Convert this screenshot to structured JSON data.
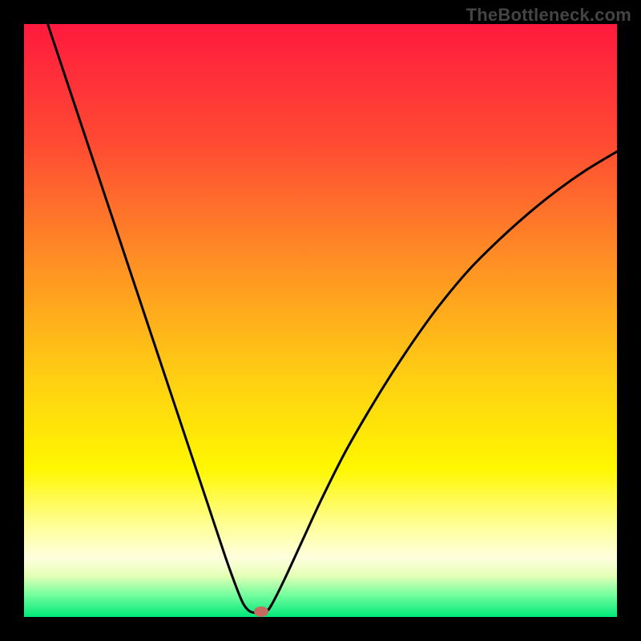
{
  "watermark": "TheBottleneck.com",
  "chart_data": {
    "type": "line",
    "title": "",
    "xlabel": "",
    "ylabel": "",
    "xlim": [
      0,
      100
    ],
    "ylim": [
      0,
      100
    ],
    "gradient_stops": [
      {
        "offset": 0.0,
        "color": "#ff1a3e"
      },
      {
        "offset": 0.2,
        "color": "#ff4a33"
      },
      {
        "offset": 0.4,
        "color": "#ff8f24"
      },
      {
        "offset": 0.6,
        "color": "#ffd012"
      },
      {
        "offset": 0.75,
        "color": "#fff700"
      },
      {
        "offset": 0.85,
        "color": "#ffff9e"
      },
      {
        "offset": 0.9,
        "color": "#ffffdf"
      },
      {
        "offset": 0.93,
        "color": "#e5ffb7"
      },
      {
        "offset": 0.96,
        "color": "#7effa1"
      },
      {
        "offset": 1.0,
        "color": "#00e879"
      }
    ],
    "series": [
      {
        "name": "left-branch",
        "points": [
          {
            "x": 4.0,
            "y": 100.0
          },
          {
            "x": 7.0,
            "y": 91.0
          },
          {
            "x": 10.0,
            "y": 82.0
          },
          {
            "x": 13.0,
            "y": 73.0
          },
          {
            "x": 16.0,
            "y": 64.0
          },
          {
            "x": 19.0,
            "y": 55.0
          },
          {
            "x": 22.0,
            "y": 46.0
          },
          {
            "x": 25.0,
            "y": 37.0
          },
          {
            "x": 28.0,
            "y": 28.0
          },
          {
            "x": 31.0,
            "y": 19.0
          },
          {
            "x": 34.0,
            "y": 10.0
          },
          {
            "x": 36.0,
            "y": 4.5
          },
          {
            "x": 37.0,
            "y": 2.2
          },
          {
            "x": 38.0,
            "y": 1.0
          },
          {
            "x": 39.0,
            "y": 0.7
          },
          {
            "x": 40.0,
            "y": 0.7
          }
        ]
      },
      {
        "name": "right-branch",
        "points": [
          {
            "x": 40.0,
            "y": 0.7
          },
          {
            "x": 41.0,
            "y": 1.0
          },
          {
            "x": 42.0,
            "y": 2.5
          },
          {
            "x": 44.0,
            "y": 6.5
          },
          {
            "x": 47.0,
            "y": 13.0
          },
          {
            "x": 50.0,
            "y": 19.5
          },
          {
            "x": 54.0,
            "y": 27.5
          },
          {
            "x": 58.0,
            "y": 34.5
          },
          {
            "x": 62.0,
            "y": 41.0
          },
          {
            "x": 66.0,
            "y": 47.0
          },
          {
            "x": 70.0,
            "y": 52.5
          },
          {
            "x": 75.0,
            "y": 58.5
          },
          {
            "x": 80.0,
            "y": 63.5
          },
          {
            "x": 85.0,
            "y": 68.0
          },
          {
            "x": 90.0,
            "y": 72.0
          },
          {
            "x": 95.0,
            "y": 75.5
          },
          {
            "x": 100.0,
            "y": 78.5
          }
        ]
      }
    ],
    "marker": {
      "x": 40.0,
      "y": 0.9,
      "color": "#c46a5e"
    }
  }
}
